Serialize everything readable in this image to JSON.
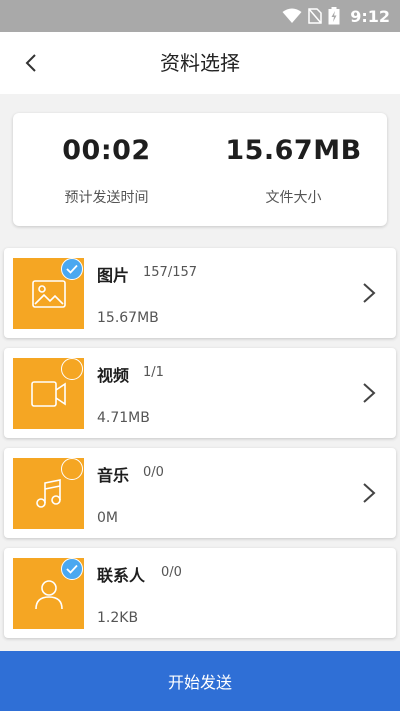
{
  "status_bar": {
    "time": "9:12"
  },
  "header": {
    "title": "资料选择"
  },
  "summary": {
    "time_value": "00:02",
    "time_label": "预计发送时间",
    "size_value": "15.67MB",
    "size_label": "文件大小"
  },
  "categories": [
    {
      "name": "图片",
      "count": "157/157",
      "size": "15.67MB",
      "selected": true,
      "icon": "image-icon"
    },
    {
      "name": "视频",
      "count": "1/1",
      "size": "4.71MB",
      "selected": false,
      "icon": "video-icon"
    },
    {
      "name": "音乐",
      "count": "0/0",
      "size": "0M",
      "selected": false,
      "icon": "music-icon"
    },
    {
      "name": "联系人",
      "count": "0/0",
      "size": "1.2KB",
      "selected": true,
      "icon": "contact-icon"
    }
  ],
  "footer": {
    "start_label": "开始发送"
  },
  "colors": {
    "accent": "#2f6fd6",
    "thumb": "#f5a623",
    "check": "#4aa8f0",
    "statusbar": "#a9a9a9"
  }
}
